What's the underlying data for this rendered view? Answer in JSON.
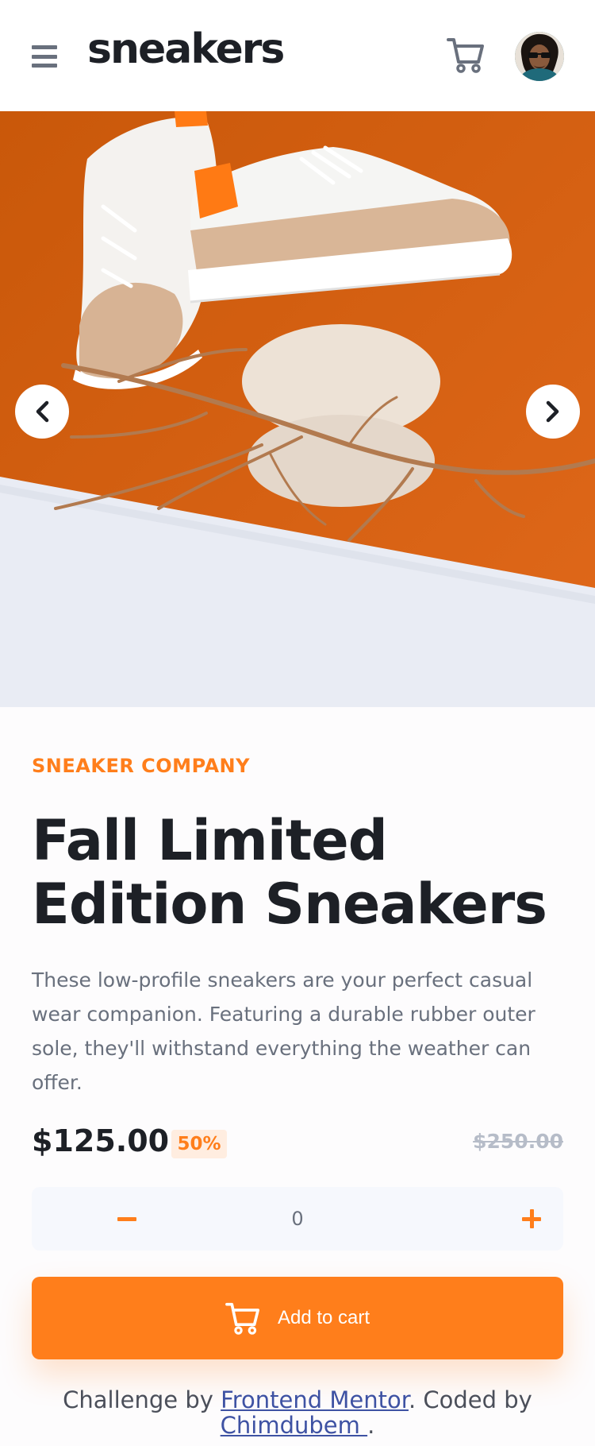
{
  "header": {
    "logo": "sneakers",
    "menu_icon": "hamburger-icon",
    "cart_icon": "cart-icon",
    "avatar": "user-avatar"
  },
  "gallery": {
    "prev_icon": "chevron-left-icon",
    "next_icon": "chevron-right-icon"
  },
  "product": {
    "company": "SNEAKER COMPANY",
    "title": "Fall Limited Edition Sneakers",
    "description": "These low-profile sneakers are your perfect casual wear companion. Featuring a durable rubber outer sole, they'll withstand everything the weather can offer.",
    "price": "$125.00",
    "discount": "50%",
    "original_price": "$250.00"
  },
  "quantity": {
    "value": "0",
    "minus_icon": "minus-icon",
    "plus_icon": "plus-icon"
  },
  "cart_button": {
    "label": "Add to cart",
    "icon": "cart-icon"
  },
  "attribution": {
    "prefix": "Challenge by ",
    "link1": "Frontend Mentor",
    "middle": ". Coded by ",
    "link2": "Chimdubem ",
    "suffix": "."
  },
  "colors": {
    "accent": "#ff7e1b",
    "accent_pale": "#ffede0",
    "text_dark": "#1d2026",
    "text_gray": "#69707d",
    "text_light": "#b6bcc8",
    "surface": "#f6f8fd",
    "link": "#3e52a3"
  }
}
